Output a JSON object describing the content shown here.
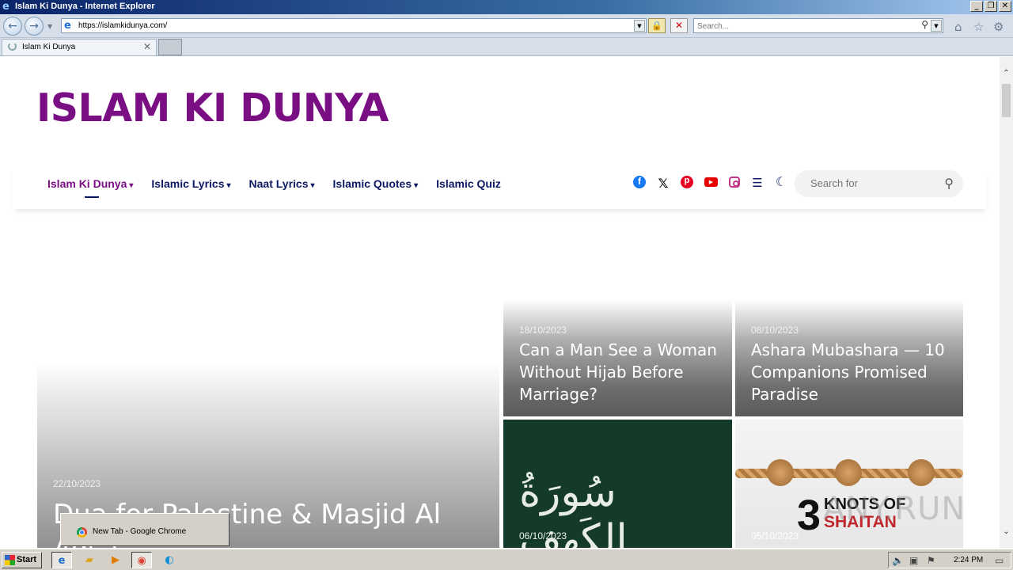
{
  "window": {
    "title": "Islam Ki Dunya - Internet Explorer",
    "controls": [
      "_",
      "❐",
      "✕"
    ]
  },
  "browser": {
    "url": "https://islamkidunya.com/",
    "search_placeholder": "Search...",
    "tab_label": "Islam Ki Dunya"
  },
  "site": {
    "logo": "ISLAM KI DUNYA",
    "brand_color": "#7a0f84",
    "nav_color": "#0d1a63",
    "menu": [
      {
        "label": "Islam Ki Dunya",
        "has_dropdown": true,
        "active": true
      },
      {
        "label": "Islamic Lyrics",
        "has_dropdown": true
      },
      {
        "label": "Naat Lyrics",
        "has_dropdown": true
      },
      {
        "label": "Islamic Quotes",
        "has_dropdown": true
      },
      {
        "label": "Islamic Quiz",
        "has_dropdown": false
      }
    ],
    "socials": [
      "facebook-icon",
      "x-icon",
      "pinterest-icon",
      "youtube-icon",
      "instagram-icon",
      "menu-icon",
      "moon-icon"
    ],
    "search_placeholder": "Search for"
  },
  "posts": {
    "featured": {
      "date": "22/10/2023",
      "title": "Dua for Palestine & Masjid Al Aqsa"
    },
    "p1": {
      "date": "18/10/2023",
      "title": "Can a Man See a Woman Without Hijab Before Marriage?"
    },
    "p2": {
      "date": "08/10/2023",
      "title": "Ashara Mubashara — 10 Companions Promised Paradise"
    },
    "p3": {
      "date": "06/10/2023",
      "image_text": "سُورَةُ الكَهف"
    },
    "p4": {
      "date": "05/10/2023",
      "image_number": "3",
      "image_line1": "KNOTS OF",
      "image_line2": "SHAITAN"
    }
  },
  "watermark": "ANY.RUN",
  "taskbar": {
    "start": "Start",
    "popup": "New Tab - Google Chrome",
    "clock": "2:24 PM"
  }
}
